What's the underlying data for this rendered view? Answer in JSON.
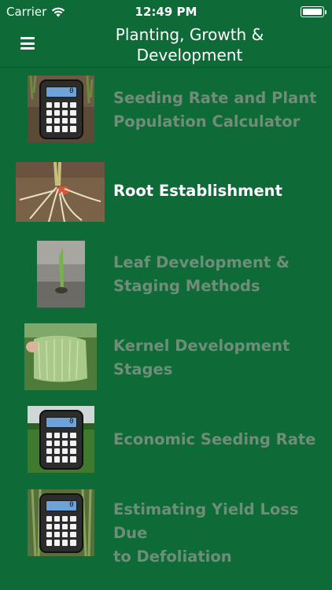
{
  "status_bar": {
    "carrier": "Carrier",
    "time": "12:49 PM",
    "wifi_icon": "wifi-icon",
    "battery_icon": "battery-icon"
  },
  "nav": {
    "menu_icon": "hamburger-menu-icon",
    "title_line1": "Planting, Growth &",
    "title_line2": "Development"
  },
  "calculator_display": "0",
  "colors": {
    "background": "#0e6a37",
    "label_inactive": "#6f8d78",
    "label_active": "#ffffff"
  },
  "items": [
    {
      "line1": "Seeding Rate and Plant",
      "line2": "Population Calculator",
      "thumbnail": "calculator-icon",
      "active": false
    },
    {
      "line1": "Root Establishment",
      "line2": "",
      "thumbnail": "root-photo",
      "active": true
    },
    {
      "line1": "Leaf Development &",
      "line2": "Staging Methods",
      "thumbnail": "seedling-photo",
      "active": false
    },
    {
      "line1": "Kernel Development",
      "line2": "Stages",
      "thumbnail": "corn-silk-photo",
      "active": false
    },
    {
      "line1": "Economic Seeding Rate",
      "line2": "",
      "thumbnail": "calculator-icon",
      "active": false
    },
    {
      "line1": "Estimating Yield Loss Due",
      "line2": "to Defoliation",
      "thumbnail": "calculator-icon",
      "active": false
    }
  ]
}
